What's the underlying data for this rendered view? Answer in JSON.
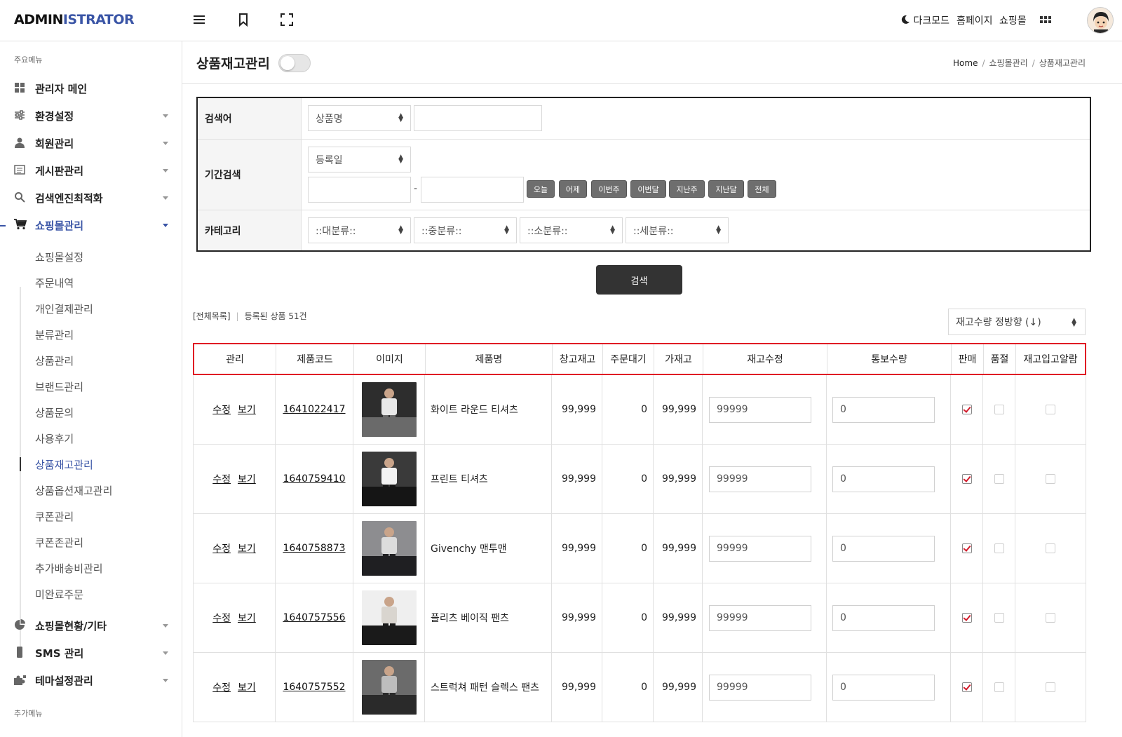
{
  "header": {
    "logo_bold": "ADMIN",
    "logo_accent": "ISTRATOR",
    "dark_mode": "다크모드",
    "homepage": "홈페이지",
    "shop": "쇼핑몰"
  },
  "sidebar": {
    "main_label": "주요메뉴",
    "extra_label": "추가메뉴",
    "items": [
      {
        "label": "관리자 메인"
      },
      {
        "label": "환경설정"
      },
      {
        "label": "회원관리"
      },
      {
        "label": "게시판관리"
      },
      {
        "label": "검색엔진최적화"
      },
      {
        "label": "쇼핑몰관리"
      },
      {
        "label": "쇼핑몰현황/기타"
      },
      {
        "label": "SMS 관리"
      },
      {
        "label": "테마설정관리"
      }
    ],
    "subitems": [
      "쇼핑몰설정",
      "주문내역",
      "개인결제관리",
      "분류관리",
      "상품관리",
      "브랜드관리",
      "상품문의",
      "사용후기",
      "상품재고관리",
      "상품옵션재고관리",
      "쿠폰관리",
      "쿠폰존관리",
      "추가배송비관리",
      "미완료주문"
    ]
  },
  "page": {
    "title": "상품재고관리",
    "breadcrumb": {
      "home": "Home",
      "parent": "쇼핑몰관리",
      "current": "상품재고관리"
    }
  },
  "search": {
    "keyword_label": "검색어",
    "keyword_select": "상품명",
    "period_label": "기간검색",
    "period_select": "등록일",
    "range_sep": "-",
    "date_buttons": [
      "오늘",
      "어제",
      "이번주",
      "이번달",
      "지난주",
      "지난달",
      "전체"
    ],
    "category_label": "카테고리",
    "category_selects": [
      "::대분류::",
      "::중분류::",
      "::소분류::",
      "::세분류::"
    ],
    "submit": "검색"
  },
  "list": {
    "all_link": "[전체목록]",
    "count_text": "등록된 상품 51건",
    "sort": "재고수량 정방향 (↓)"
  },
  "table": {
    "headers": [
      "관리",
      "제품코드",
      "이미지",
      "제품명",
      "창고재고",
      "주문대기",
      "가재고",
      "재고수정",
      "통보수량",
      "판매",
      "품절",
      "재고입고알람"
    ],
    "edit_label": "수정",
    "view_label": "보기",
    "rows": [
      {
        "code": "1641022417",
        "name": "화이트 라운드 티셔츠",
        "stock": "99,999",
        "pending": "0",
        "virtual": "99,999",
        "edit_qty": "99999",
        "notify_qty": "0",
        "on_sale": true,
        "sold_out": false,
        "alarm": false
      },
      {
        "code": "1640759410",
        "name": "프린트 티셔츠",
        "stock": "99,999",
        "pending": "0",
        "virtual": "99,999",
        "edit_qty": "99999",
        "notify_qty": "0",
        "on_sale": true,
        "sold_out": false,
        "alarm": false
      },
      {
        "code": "1640758873",
        "name": "Givenchy 맨투맨",
        "stock": "99,999",
        "pending": "0",
        "virtual": "99,999",
        "edit_qty": "99999",
        "notify_qty": "0",
        "on_sale": true,
        "sold_out": false,
        "alarm": false
      },
      {
        "code": "1640757556",
        "name": "플리츠 베이직 팬츠",
        "stock": "99,999",
        "pending": "0",
        "virtual": "99,999",
        "edit_qty": "99999",
        "notify_qty": "0",
        "on_sale": true,
        "sold_out": false,
        "alarm": false
      },
      {
        "code": "1640757552",
        "name": "스트럭쳐 패턴 슬렉스 팬츠",
        "stock": "99,999",
        "pending": "0",
        "virtual": "99,999",
        "edit_qty": "99999",
        "notify_qty": "0",
        "on_sale": true,
        "sold_out": false,
        "alarm": false
      }
    ]
  },
  "colors": {
    "accent": "#3a55a6",
    "highlight": "#e01b24",
    "dark_button": "#333333"
  }
}
